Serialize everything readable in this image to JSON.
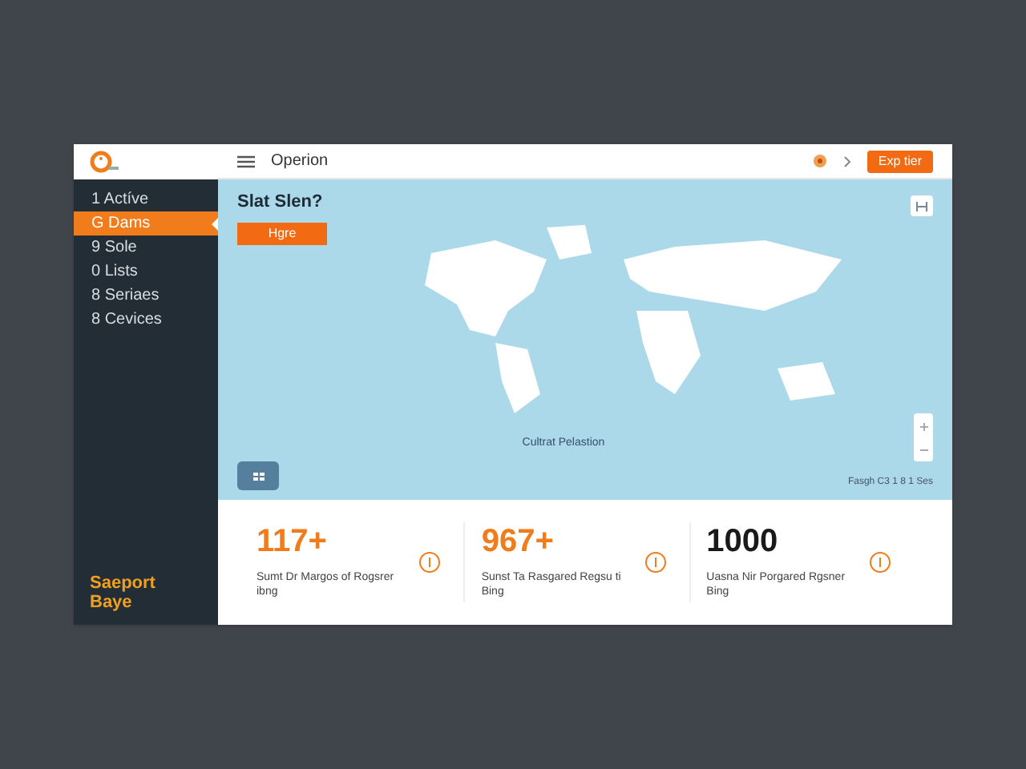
{
  "header": {
    "title": "Operion",
    "action_button": "Exp tier"
  },
  "sidebar": {
    "items": [
      {
        "label": "1 Actíve",
        "selected": false
      },
      {
        "label": "G Dams",
        "selected": true
      },
      {
        "label": "9 Sole",
        "selected": false
      },
      {
        "label": "0 Lists",
        "selected": false
      },
      {
        "label": "8 Seriaes",
        "selected": false
      },
      {
        "label": "8 Cevices",
        "selected": false
      }
    ],
    "footer": "Saeport Baye"
  },
  "map": {
    "heading": "Slat Slen?",
    "button": "Hgre",
    "caption": "Cultrat Pelastion",
    "attribution": "Fasgh C3 1 8 1 Ses"
  },
  "stats": [
    {
      "value": "117+",
      "label": "Sumt Dr Margos of Rogsrer ibng",
      "color": "#f07c1c"
    },
    {
      "value": "967+",
      "label": "Sunst Ta Rasgared Regsu ti Bing",
      "color": "#f07c1c"
    },
    {
      "value": "1000",
      "label": "Uasna Nir Porgared Rgsner Bing",
      "color": "#1a1a1a"
    }
  ]
}
